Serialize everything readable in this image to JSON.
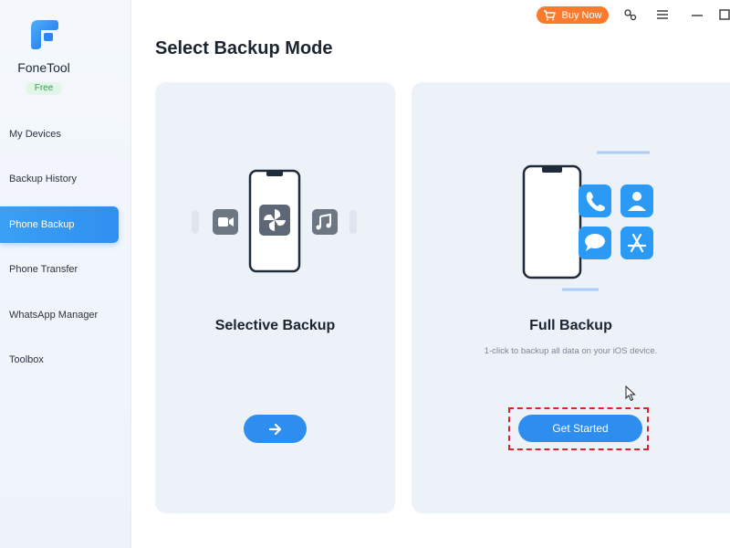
{
  "app": {
    "name": "FoneTool",
    "badge": "Free"
  },
  "sidebar": {
    "items": [
      {
        "label": "My Devices"
      },
      {
        "label": "Backup History"
      },
      {
        "label": "Phone Backup"
      },
      {
        "label": "Phone Transfer"
      },
      {
        "label": "WhatsApp Manager"
      },
      {
        "label": "Toolbox"
      }
    ],
    "active_index": 2
  },
  "titlebar": {
    "buy_label": "Buy Now",
    "icons": [
      "cart-icon",
      "link-icon",
      "menu-icon",
      "minimize-icon",
      "maximize-icon"
    ]
  },
  "main": {
    "title": "Select Backup Mode",
    "cards": [
      {
        "title": "Selective Backup",
        "description": "",
        "button_icon": "arrow-right-icon"
      },
      {
        "title": "Full Backup",
        "description": "1-click to backup all data on your iOS device.",
        "button_label": "Get Started"
      }
    ]
  },
  "colors": {
    "accent": "#2e8ef0",
    "buy": "#fb7a2c",
    "highlight": "#d9232e",
    "card_bg": "#edf2f9"
  }
}
